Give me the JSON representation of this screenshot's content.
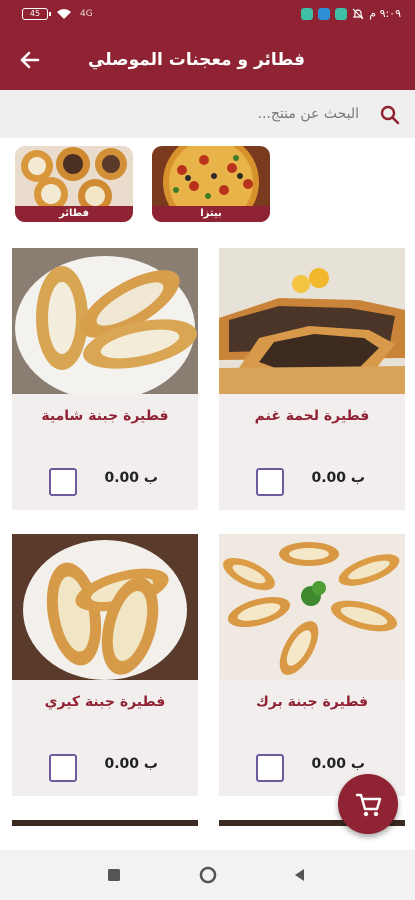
{
  "status_bar": {
    "time": "٩:٠٩ م",
    "battery": "45",
    "network": "4G"
  },
  "app_bar": {
    "title": "فطائر و معجنات الموصلي",
    "back_icon": "arrow-left-icon"
  },
  "search": {
    "placeholder": "البحث عن منتج...",
    "icon": "search-icon"
  },
  "categories": [
    {
      "label": "بيتزا"
    },
    {
      "label": "فطائر"
    }
  ],
  "products": [
    {
      "name": "فطيرة لحمة غنم",
      "price": "0.00 ب"
    },
    {
      "name": "فطيرة جبنة شامية",
      "price": "0.00 ب"
    },
    {
      "name": "فطيرة جبنة برك",
      "price": "0.00 ب"
    },
    {
      "name": "فطيرة جبنة كيري",
      "price": "0.00 ب"
    }
  ],
  "fab": {
    "icon": "cart-icon"
  },
  "colors": {
    "primary": "#8f2333",
    "card_bg": "#f3eeee",
    "checkbox": "#6e5a9e"
  }
}
